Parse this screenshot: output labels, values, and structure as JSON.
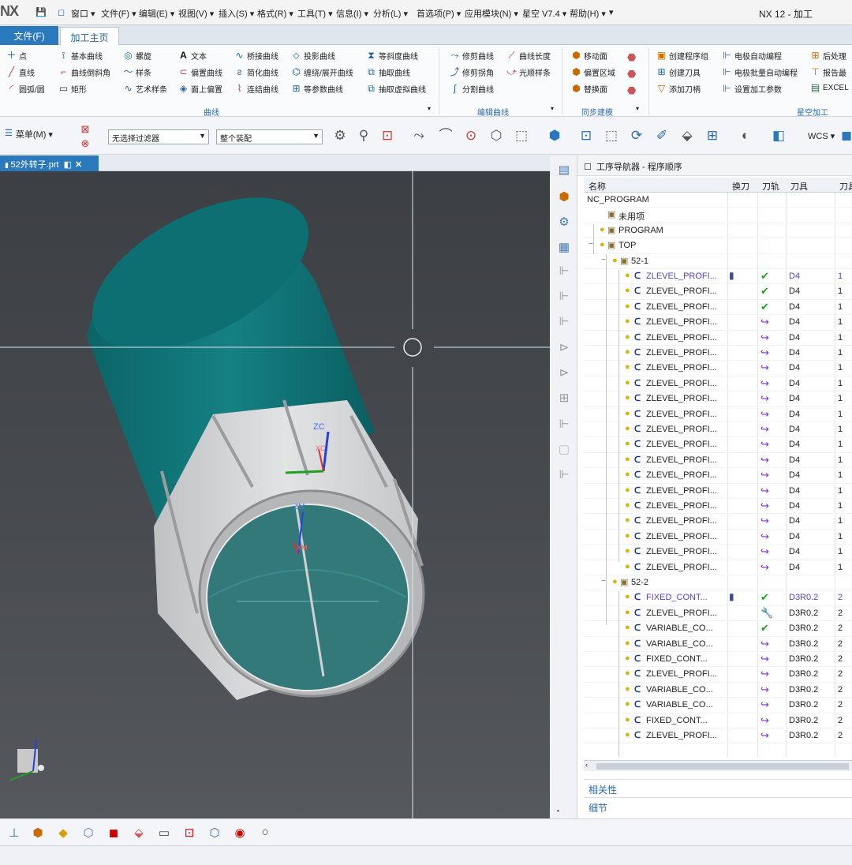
{
  "titlebar": {
    "logo": "NX",
    "app_title": "NX 12 - 加工",
    "menus": [
      "窗口 ▾",
      "文件(F) ▾",
      "编辑(E) ▾",
      "视图(V) ▾",
      "插入(S) ▾",
      "格式(R) ▾",
      "工具(T) ▾",
      "信息(I) ▾",
      "分析(L) ▾",
      "首选项(P) ▾",
      "应用模块(N) ▾",
      "星空 V7.4 ▾",
      "帮助(H) ▾"
    ]
  },
  "tabs": {
    "file": "文件(F)",
    "home": "加工主页"
  },
  "ribbon": {
    "curve": [
      "点",
      "基本曲线",
      "螺旋",
      "文本",
      "桥接曲线",
      "投影曲线",
      "等斜度曲线",
      "直线",
      "曲线倒斜角",
      "样条",
      "偏置曲线",
      "简化曲线",
      "缠绕/展开曲线",
      "抽取曲线",
      "圆弧/圆",
      "矩形",
      "艺术样条",
      "面上偏置",
      "连结曲线",
      "等参数曲线",
      "抽取虚拟曲线"
    ],
    "edit_curve": [
      "修剪曲线",
      "曲线长度",
      "修剪拐角",
      "光顺样条",
      "分割曲线"
    ],
    "sync": [
      "移动面",
      "偏置区域",
      "替换面"
    ],
    "xingkong": [
      "创建程序组",
      "电极自动编程",
      "后处理",
      "创建刀具",
      "电极批量自动编程",
      "报告最",
      "添加刀柄",
      "设置加工参数",
      "EXCEL"
    ],
    "group_labels": [
      "曲线",
      "编辑曲线",
      "同步建模",
      "星空加工"
    ]
  },
  "toolbar": {
    "menu_label": "菜单(M) ▾",
    "filter": "无选择过滤器",
    "assembly": "整个装配",
    "wcs": "WCS ▾"
  },
  "doc": {
    "tab": "52外转子.prt"
  },
  "viewport": {
    "zc": "ZC",
    "yc": "YC",
    "xc": "XC",
    "zm": "ZM",
    "xm": "XM"
  },
  "navigator": {
    "title": "工序导航器 - 程序顺序",
    "columns": [
      "名称",
      "换刀",
      "刀轨",
      "刀具",
      "刀具"
    ],
    "rows": [
      {
        "name": "NC_PROGRAM",
        "level": 0,
        "kind": "root",
        "tc": "",
        "path": "",
        "tool": "",
        "num": ""
      },
      {
        "name": "未用项",
        "level": 1,
        "kind": "folder",
        "tc": "",
        "path": "",
        "tool": "",
        "num": ""
      },
      {
        "name": "PROGRAM",
        "level": 1,
        "kind": "program",
        "tc": "",
        "path": "",
        "tool": "",
        "num": ""
      },
      {
        "name": "TOP",
        "level": 1,
        "kind": "program",
        "tc": "",
        "path": "",
        "tool": "",
        "num": ""
      },
      {
        "name": "52-1",
        "level": 2,
        "kind": "program",
        "tc": "",
        "path": "",
        "tool": "",
        "num": ""
      },
      {
        "name": "ZLEVEL_PROFI...",
        "level": 3,
        "kind": "op",
        "tc": "▮",
        "path": "ok",
        "tool": "D4",
        "num": "1",
        "hl": true
      },
      {
        "name": "ZLEVEL_PROFI...",
        "level": 3,
        "kind": "op",
        "tc": "",
        "path": "ok",
        "tool": "D4",
        "num": "1"
      },
      {
        "name": "ZLEVEL_PROFI...",
        "level": 3,
        "kind": "op",
        "tc": "",
        "path": "ok",
        "tool": "D4",
        "num": "1"
      },
      {
        "name": "ZLEVEL_PROFI...",
        "level": 3,
        "kind": "op",
        "tc": "",
        "path": "re",
        "tool": "D4",
        "num": "1"
      },
      {
        "name": "ZLEVEL_PROFI...",
        "level": 3,
        "kind": "op",
        "tc": "",
        "path": "re",
        "tool": "D4",
        "num": "1"
      },
      {
        "name": "ZLEVEL_PROFI...",
        "level": 3,
        "kind": "op",
        "tc": "",
        "path": "re",
        "tool": "D4",
        "num": "1"
      },
      {
        "name": "ZLEVEL_PROFI...",
        "level": 3,
        "kind": "op",
        "tc": "",
        "path": "re",
        "tool": "D4",
        "num": "1"
      },
      {
        "name": "ZLEVEL_PROFI...",
        "level": 3,
        "kind": "op",
        "tc": "",
        "path": "re",
        "tool": "D4",
        "num": "1"
      },
      {
        "name": "ZLEVEL_PROFI...",
        "level": 3,
        "kind": "op",
        "tc": "",
        "path": "re",
        "tool": "D4",
        "num": "1"
      },
      {
        "name": "ZLEVEL_PROFI...",
        "level": 3,
        "kind": "op",
        "tc": "",
        "path": "re",
        "tool": "D4",
        "num": "1"
      },
      {
        "name": "ZLEVEL_PROFI...",
        "level": 3,
        "kind": "op",
        "tc": "",
        "path": "re",
        "tool": "D4",
        "num": "1"
      },
      {
        "name": "ZLEVEL_PROFI...",
        "level": 3,
        "kind": "op",
        "tc": "",
        "path": "re",
        "tool": "D4",
        "num": "1"
      },
      {
        "name": "ZLEVEL_PROFI...",
        "level": 3,
        "kind": "op",
        "tc": "",
        "path": "re",
        "tool": "D4",
        "num": "1"
      },
      {
        "name": "ZLEVEL_PROFI...",
        "level": 3,
        "kind": "op",
        "tc": "",
        "path": "re",
        "tool": "D4",
        "num": "1"
      },
      {
        "name": "ZLEVEL_PROFI...",
        "level": 3,
        "kind": "op",
        "tc": "",
        "path": "re",
        "tool": "D4",
        "num": "1"
      },
      {
        "name": "ZLEVEL_PROFI...",
        "level": 3,
        "kind": "op",
        "tc": "",
        "path": "re",
        "tool": "D4",
        "num": "1"
      },
      {
        "name": "ZLEVEL_PROFI...",
        "level": 3,
        "kind": "op",
        "tc": "",
        "path": "re",
        "tool": "D4",
        "num": "1"
      },
      {
        "name": "ZLEVEL_PROFI...",
        "level": 3,
        "kind": "op",
        "tc": "",
        "path": "re",
        "tool": "D4",
        "num": "1"
      },
      {
        "name": "ZLEVEL_PROFI...",
        "level": 3,
        "kind": "op",
        "tc": "",
        "path": "re",
        "tool": "D4",
        "num": "1"
      },
      {
        "name": "ZLEVEL_PROFI...",
        "level": 3,
        "kind": "op",
        "tc": "",
        "path": "re",
        "tool": "D4",
        "num": "1"
      },
      {
        "name": "52-2",
        "level": 2,
        "kind": "program",
        "tc": "",
        "path": "",
        "tool": "",
        "num": ""
      },
      {
        "name": "FIXED_CONT...",
        "level": 3,
        "kind": "op",
        "tc": "▮",
        "path": "ok",
        "tool": "D3R0.2",
        "num": "2",
        "hl": true
      },
      {
        "name": "ZLEVEL_PROFI...",
        "level": 3,
        "kind": "op",
        "tc": "",
        "path": "wr",
        "tool": "D3R0.2",
        "num": "2"
      },
      {
        "name": "VARIABLE_CO...",
        "level": 3,
        "kind": "op",
        "tc": "",
        "path": "ok",
        "tool": "D3R0.2",
        "num": "2"
      },
      {
        "name": "VARIABLE_CO...",
        "level": 3,
        "kind": "op",
        "tc": "",
        "path": "re",
        "tool": "D3R0.2",
        "num": "2"
      },
      {
        "name": "FIXED_CONT...",
        "level": 3,
        "kind": "op",
        "tc": "",
        "path": "re",
        "tool": "D3R0.2",
        "num": "2"
      },
      {
        "name": "ZLEVEL_PROFI...",
        "level": 3,
        "kind": "op",
        "tc": "",
        "path": "re",
        "tool": "D3R0.2",
        "num": "2"
      },
      {
        "name": "VARIABLE_CO...",
        "level": 3,
        "kind": "op",
        "tc": "",
        "path": "re",
        "tool": "D3R0.2",
        "num": "2"
      },
      {
        "name": "VARIABLE_CO...",
        "level": 3,
        "kind": "op",
        "tc": "",
        "path": "re",
        "tool": "D3R0.2",
        "num": "2"
      },
      {
        "name": "FIXED_CONT...",
        "level": 3,
        "kind": "op",
        "tc": "",
        "path": "re",
        "tool": "D3R0.2",
        "num": "2"
      },
      {
        "name": "ZLEVEL_PROFI...",
        "level": 3,
        "kind": "op",
        "tc": "",
        "path": "re",
        "tool": "D3R0.2",
        "num": "2"
      }
    ],
    "sections": [
      "相关性",
      "细节"
    ]
  },
  "colors": {
    "accent": "#2b79bd",
    "teal": "#0f7b7e",
    "check": "#20a020",
    "regen": "#8a2be2",
    "wrench": "#d08a00"
  }
}
